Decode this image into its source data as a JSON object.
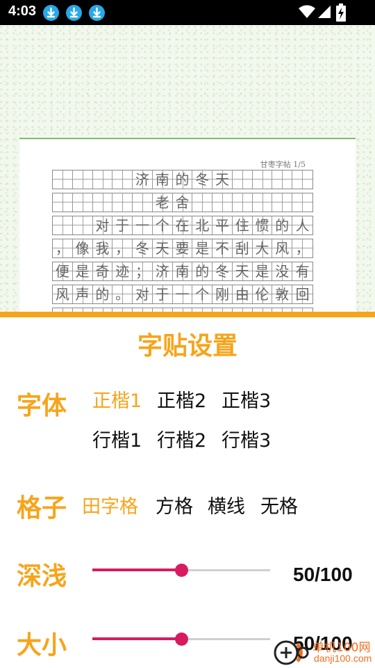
{
  "status_bar": {
    "time": "4:03",
    "notifications": [
      "download-icon",
      "download-icon",
      "download-icon"
    ],
    "icons": [
      "wifi-icon",
      "signal-icon",
      "battery-charging-icon"
    ]
  },
  "preview": {
    "header": "甘枣字帖 1/5",
    "rows": [
      [
        "",
        "",
        "",
        "",
        "济",
        "南",
        "的",
        "冬",
        "天",
        "",
        "",
        "",
        ""
      ],
      [
        "",
        "",
        "",
        "",
        "",
        "老",
        "舍",
        "",
        "",
        "",
        "",
        "",
        ""
      ],
      [
        "",
        "",
        "对",
        "于",
        "一",
        "个",
        "在",
        "北",
        "平",
        "住",
        "惯",
        "的",
        "人"
      ],
      [
        "，",
        "像",
        "我",
        "，",
        "冬",
        "天",
        "要",
        "是",
        "不",
        "刮",
        "大",
        "风",
        "，"
      ],
      [
        "便",
        "是",
        "奇",
        "迹",
        "；",
        "济",
        "南",
        "的",
        "冬",
        "天",
        "是",
        "没",
        "有"
      ],
      [
        "风",
        "声",
        "的",
        "。",
        "对",
        "于",
        "一",
        "个",
        "刚",
        "由",
        "伦",
        "敦",
        "回"
      ],
      [
        "",
        "",
        "",
        "",
        "",
        "",
        "",
        "",
        "",
        "",
        "",
        "",
        ""
      ]
    ]
  },
  "settings": {
    "title": "字贴设置",
    "font": {
      "label": "字体",
      "options": [
        "正楷1",
        "正楷2",
        "正楷3",
        "行楷1",
        "行楷2",
        "行楷3"
      ],
      "selected": "正楷1"
    },
    "grid": {
      "label": "格子",
      "options": [
        "田字格",
        "方格",
        "横线",
        "无格"
      ],
      "selected": "田字格"
    },
    "depth": {
      "label": "深浅",
      "value": 50,
      "max": 100,
      "display": "50/100"
    },
    "size": {
      "label": "大小",
      "value": 50,
      "max": 100,
      "display": "50/100"
    },
    "accent_color": "#f7a41a",
    "slider_color": "#d81b60"
  },
  "watermark": {
    "cn": "单机100网",
    "en": "danji100.com"
  }
}
